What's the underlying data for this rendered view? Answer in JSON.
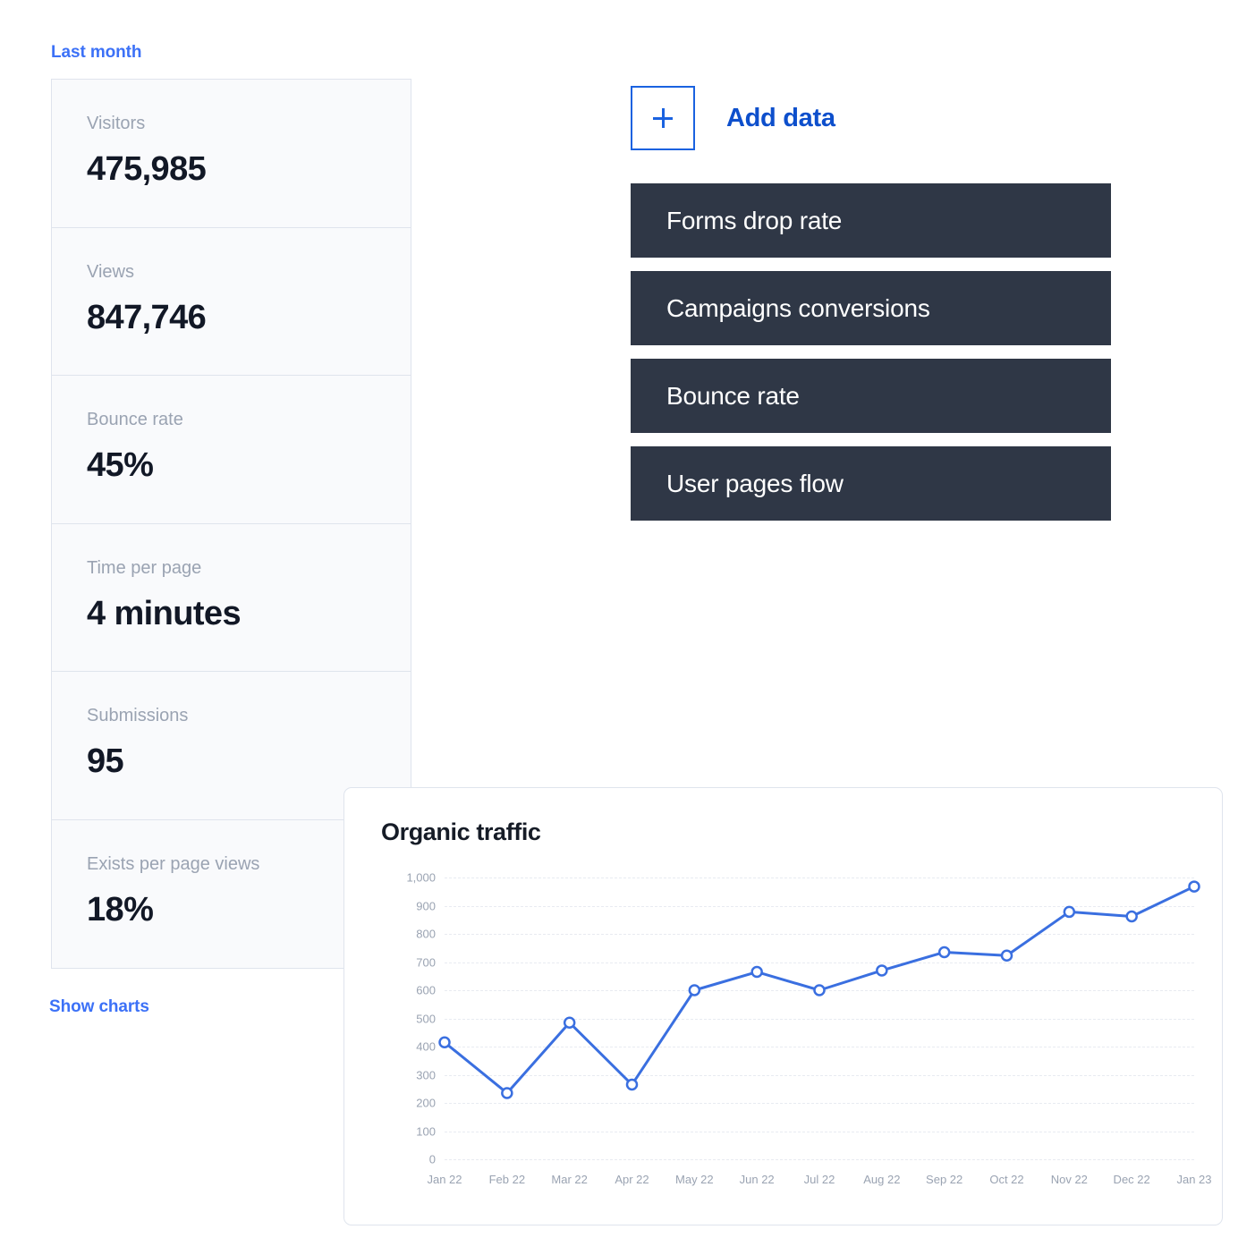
{
  "sidebar": {
    "heading": "Last month",
    "metrics": [
      {
        "label": "Visitors",
        "value": "475,985"
      },
      {
        "label": "Views",
        "value": "847,746"
      },
      {
        "label": "Bounce rate",
        "value": "45%"
      },
      {
        "label": "Time per page",
        "value": "4 minutes"
      },
      {
        "label": "Submissions",
        "value": "95"
      },
      {
        "label": "Exists per page views",
        "value": "18%"
      }
    ],
    "show_charts_label": "Show charts"
  },
  "add_data": {
    "plus_icon": "plus-icon",
    "label": "Add data",
    "options": [
      "Forms drop rate",
      "Campaigns conversions",
      "Bounce rate",
      "User pages flow"
    ]
  },
  "colors": {
    "accent_blue": "#0d4fcc",
    "link_blue": "#3c71f7",
    "dark_button": "#2f3746",
    "card_bg": "#f9fafc",
    "border": "#dfe4ed",
    "series_line": "#3a6fe0"
  },
  "chart_data": {
    "type": "line",
    "title": "Organic traffic",
    "xlabel": "",
    "ylabel": "",
    "grid": true,
    "legend": "none",
    "ylim": [
      0,
      1000
    ],
    "yticks": [
      0,
      100,
      200,
      300,
      400,
      500,
      600,
      700,
      800,
      900,
      1000
    ],
    "ytick_labels": [
      "0",
      "100",
      "200",
      "300",
      "400",
      "500",
      "600",
      "700",
      "800",
      "900",
      "1,000"
    ],
    "categories": [
      "Jan 22",
      "Feb 22",
      "Mar 22",
      "Apr 22",
      "May 22",
      "Jun 22",
      "Jul 22",
      "Aug 22",
      "Sep 22",
      "Oct 22",
      "Nov 22",
      "Dec 22",
      "Jan 23"
    ],
    "series": [
      {
        "name": "Organic traffic",
        "color": "#3a6fe0",
        "values": [
          415,
          235,
          485,
          265,
          600,
          665,
          600,
          670,
          735,
          723,
          878,
          862,
          968
        ]
      }
    ]
  }
}
